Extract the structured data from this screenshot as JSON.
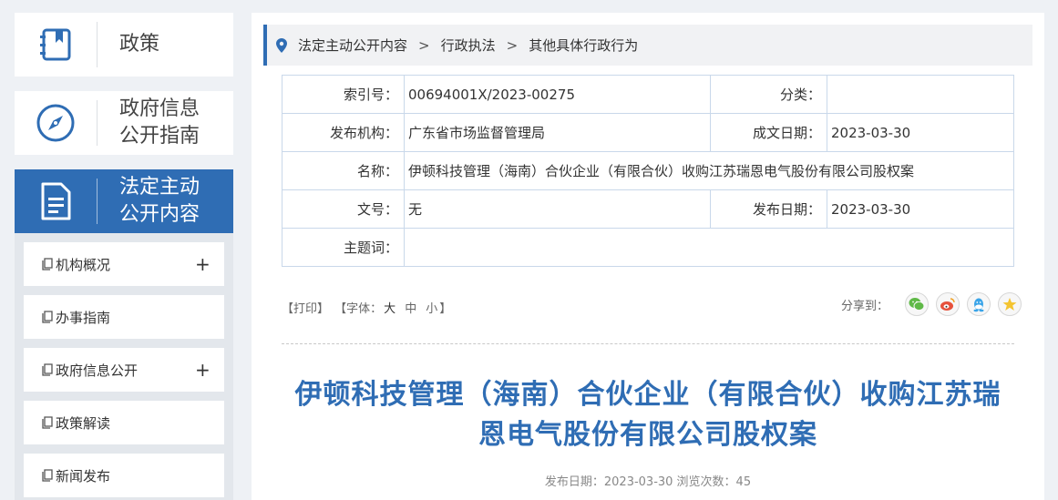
{
  "sidebar": {
    "big_items": [
      {
        "line1": "政策",
        "line2": "",
        "icon": "book-icon"
      },
      {
        "line1": "政府信息",
        "line2": "公开指南",
        "icon": "compass-icon"
      },
      {
        "line1": "法定主动",
        "line2": "公开内容",
        "icon": "document-icon"
      }
    ],
    "sub_items": [
      {
        "label": "机构概况",
        "expand": "+"
      },
      {
        "label": "办事指南",
        "expand": ""
      },
      {
        "label": "政府信息公开",
        "expand": "+"
      },
      {
        "label": "政策解读",
        "expand": ""
      },
      {
        "label": "新闻发布",
        "expand": ""
      }
    ]
  },
  "breadcrumb": {
    "items": [
      "法定主动公开内容",
      "行政执法",
      "其他具体行政行为"
    ],
    "separator": ">"
  },
  "info_table": {
    "index_label": "索引号：",
    "index_value": "00694001X/2023-00275",
    "category_label": "分类：",
    "category_value": "",
    "publisher_label": "发布机构：",
    "publisher_value": "广东省市场监督管理局",
    "written_date_label": "成文日期：",
    "written_date_value": "2023-03-30",
    "name_label": "名称：",
    "name_value": "伊顿科技管理（海南）合伙企业（有限合伙）收购江苏瑞恩电气股份有限公司股权案",
    "doc_no_label": "文号：",
    "doc_no_value": "无",
    "publish_date_label": "发布日期：",
    "publish_date_value": "2023-03-30",
    "keywords_label": "主题词：",
    "keywords_value": ""
  },
  "tools": {
    "print": "【打印】",
    "font_prefix": "【字体：",
    "font_large": "大",
    "font_medium": "中",
    "font_small": "小",
    "font_suffix": "】"
  },
  "share": {
    "label": "分享到：",
    "icons": [
      "wechat-icon",
      "weibo-icon",
      "qq-icon",
      "qzone-icon"
    ]
  },
  "article": {
    "title_line1": "伊顿科技管理（海南）合伙企业（有限合伙）收购江苏瑞",
    "title_line2": "恩电气股份有限公司股权案",
    "meta": "发布日期：2023-03-30  浏览次数：45"
  },
  "colors": {
    "accent": "#2f6db4",
    "title": "#2f6db4",
    "table_border": "#c9d8ea"
  }
}
